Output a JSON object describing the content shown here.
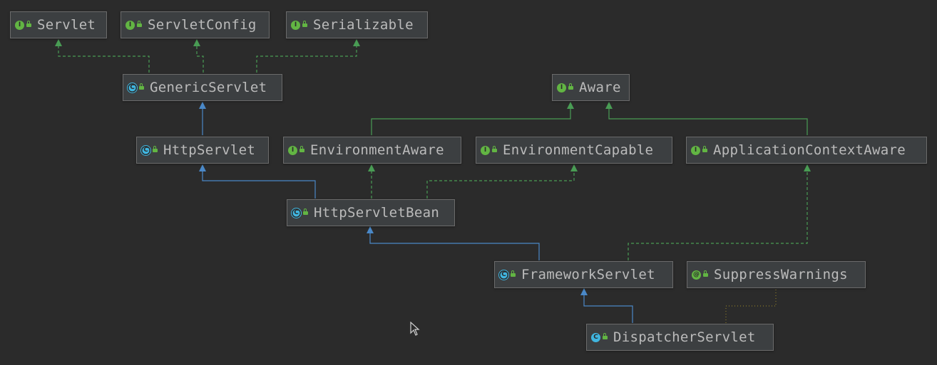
{
  "diagram": {
    "colors": {
      "background": "#2b2b2b",
      "node_fill": "#3c3f41",
      "node_border": "#6b6b6b",
      "text": "#bbbbbb",
      "extends_edge": "#4a88c7",
      "implements_edge": "#499c54",
      "annotation_edge": "#8a7a2a"
    },
    "nodes": {
      "servlet": {
        "label": "Servlet",
        "kind": "interface"
      },
      "servlet_config": {
        "label": "ServletConfig",
        "kind": "interface"
      },
      "serializable": {
        "label": "Serializable",
        "kind": "interface"
      },
      "generic_servlet": {
        "label": "GenericServlet",
        "kind": "abstract-class"
      },
      "aware": {
        "label": "Aware",
        "kind": "interface"
      },
      "http_servlet": {
        "label": "HttpServlet",
        "kind": "abstract-class"
      },
      "environment_aware": {
        "label": "EnvironmentAware",
        "kind": "interface"
      },
      "environment_capable": {
        "label": "EnvironmentCapable",
        "kind": "interface"
      },
      "application_context_aware": {
        "label": "ApplicationContextAware",
        "kind": "interface"
      },
      "http_servlet_bean": {
        "label": "HttpServletBean",
        "kind": "abstract-class"
      },
      "framework_servlet": {
        "label": "FrameworkServlet",
        "kind": "abstract-class"
      },
      "suppress_warnings": {
        "label": "SuppressWarnings",
        "kind": "annotation"
      },
      "dispatcher_servlet": {
        "label": "DispatcherServlet",
        "kind": "class"
      }
    },
    "edges": [
      {
        "from": "generic_servlet",
        "to": "servlet",
        "type": "implements"
      },
      {
        "from": "generic_servlet",
        "to": "servlet_config",
        "type": "implements"
      },
      {
        "from": "generic_servlet",
        "to": "serializable",
        "type": "implements"
      },
      {
        "from": "http_servlet",
        "to": "generic_servlet",
        "type": "extends"
      },
      {
        "from": "environment_aware",
        "to": "aware",
        "type": "interface-extends"
      },
      {
        "from": "application_context_aware",
        "to": "aware",
        "type": "interface-extends"
      },
      {
        "from": "http_servlet_bean",
        "to": "http_servlet",
        "type": "extends"
      },
      {
        "from": "http_servlet_bean",
        "to": "environment_aware",
        "type": "implements"
      },
      {
        "from": "http_servlet_bean",
        "to": "environment_capable",
        "type": "implements"
      },
      {
        "from": "framework_servlet",
        "to": "http_servlet_bean",
        "type": "extends"
      },
      {
        "from": "framework_servlet",
        "to": "application_context_aware",
        "type": "implements"
      },
      {
        "from": "dispatcher_servlet",
        "to": "framework_servlet",
        "type": "extends"
      },
      {
        "from": "dispatcher_servlet",
        "to": "suppress_warnings",
        "type": "annotated-with"
      }
    ]
  }
}
